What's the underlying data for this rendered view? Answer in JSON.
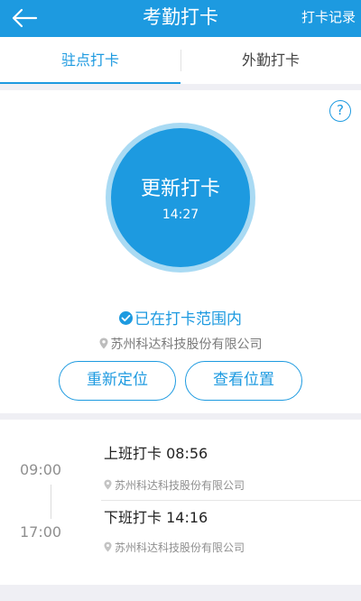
{
  "header": {
    "back_icon": "back-arrow-icon",
    "title": "考勤打卡",
    "record_link": "打卡记录"
  },
  "tabs": [
    {
      "label": "驻点打卡",
      "active": true
    },
    {
      "label": "外勤打卡",
      "active": false
    }
  ],
  "punch": {
    "help_icon": "question-icon",
    "button_label": "更新打卡",
    "time": "14:27",
    "range_status": "已在打卡范围内",
    "company": "苏州科达科技股份有限公司",
    "relocate_label": "重新定位",
    "view_location_label": "查看位置"
  },
  "records": {
    "start_time": "09:00",
    "end_time": "17:00",
    "items": [
      {
        "title": "上班打卡 08:56",
        "address": "苏州科达科技股份有限公司"
      },
      {
        "title": "下班打卡 14:16",
        "address": "苏州科达科技股份有限公司"
      }
    ]
  },
  "colors": {
    "accent": "#1d9ae0",
    "ring": "#a9daf3",
    "background": "#efeff4"
  }
}
